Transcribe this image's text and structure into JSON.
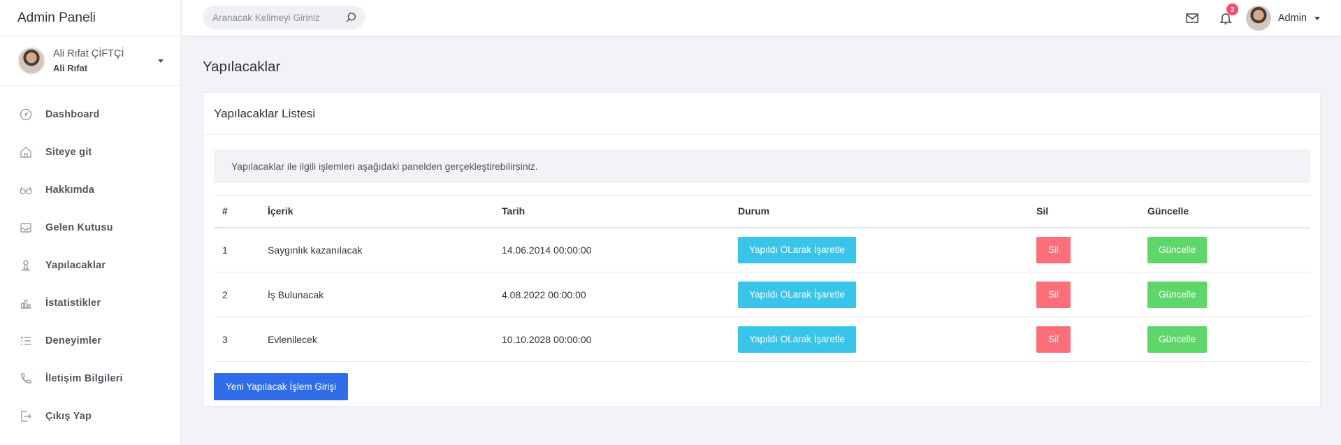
{
  "brand": "Admin Paneli",
  "user": {
    "name": "Ali Rıfat ÇİFTÇİ",
    "sub": "Ali Rıfat"
  },
  "sidebar": {
    "items": [
      {
        "label": "Dashboard",
        "icon": "dashboard-icon"
      },
      {
        "label": "Siteye git",
        "icon": "home-icon"
      },
      {
        "label": "Hakkımda",
        "icon": "glasses-icon"
      },
      {
        "label": "Gelen Kutusu",
        "icon": "inbox-icon"
      },
      {
        "label": "Yapılacaklar",
        "icon": "todo-icon"
      },
      {
        "label": "İstatistikler",
        "icon": "bar-chart-icon"
      },
      {
        "label": "Deneyimler",
        "icon": "list-icon"
      },
      {
        "label": "İletişim Bilgileri",
        "icon": "phone-icon"
      },
      {
        "label": "Çıkış Yap",
        "icon": "logout-icon"
      }
    ]
  },
  "search": {
    "placeholder": "Aranacak Kelimeyi Giriniz",
    "value": ""
  },
  "header": {
    "notification_count": "3",
    "admin_label": "Admin"
  },
  "page": {
    "title": "Yapılacaklar",
    "card_title": "Yapılacaklar Listesi",
    "info": "Yapılacaklar ile ilgili işlemleri aşağıdaki panelden gerçekleştirebilirsiniz.",
    "columns": [
      "#",
      "İçerik",
      "Tarih",
      "Durum",
      "Sil",
      "Güncelle"
    ],
    "rows": [
      {
        "no": "1",
        "content": "Saygınlık kazanılacak",
        "date": "14.06.2014 00:00:00"
      },
      {
        "no": "2",
        "content": "İş Bulunacak",
        "date": "4.08.2022 00:00:00"
      },
      {
        "no": "3",
        "content": "Evlenilecek",
        "date": "10.10.2028 00:00:00"
      }
    ],
    "status_button": "Yapıldı OLarak İşaretle",
    "delete_button": "Sil",
    "update_button": "Güncelle",
    "new_button": "Yeni Yapılacak İşlem Girişi"
  },
  "colors": {
    "info": "#39c4ea",
    "danger": "#fb6f7a",
    "success": "#5fd66a",
    "primary": "#2f6de9",
    "badge": "#fc4b6c"
  }
}
